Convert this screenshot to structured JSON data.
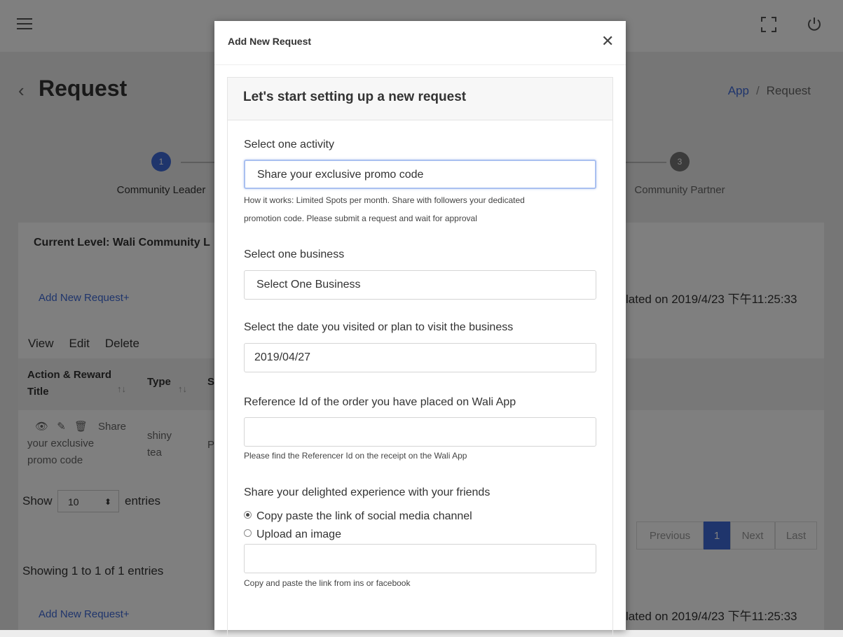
{
  "header": {
    "menu_icon": "hamburger-icon",
    "fullscreen_icon": "fullscreen-icon",
    "power_icon": "power-icon"
  },
  "page": {
    "title": "Request",
    "back_icon": "chevron-left-icon"
  },
  "breadcrumb": {
    "app": "App",
    "separator": "/",
    "current": "Request"
  },
  "steps": [
    {
      "number": "1",
      "label": "Community Leader",
      "color": "#3f6ad8"
    },
    {
      "number": "3",
      "label": "Community Partner",
      "color": "#777777"
    }
  ],
  "level": {
    "text": "Current Level: Wali Community L"
  },
  "add_request": {
    "top_label": "Add New Request+",
    "bottom_label": "Add New Request+"
  },
  "updated": {
    "top": "lated on 2019/4/23 下午11:25:33",
    "bottom": "lated on 2019/4/23 下午11:25:33"
  },
  "toolbar": {
    "view": "View",
    "edit": "Edit",
    "delete": "Delete"
  },
  "table": {
    "headers": {
      "title_line1": "Action & Reward",
      "title_line2": "Title",
      "type": "Type",
      "status_partial": "S"
    },
    "row": {
      "title_suffix": "Share",
      "title_line2": "your exclusive",
      "title_line3": "promo code",
      "type_line1": "shiny",
      "type_line2": "tea",
      "extra": "P"
    }
  },
  "entries": {
    "show": "Show",
    "value": "10",
    "suffix": "entries",
    "summary": "Showing 1 to 1 of 1 entries"
  },
  "pagination": {
    "previous": "Previous",
    "page": "1",
    "next": "Next",
    "last": "Last"
  },
  "modal": {
    "title": "Add New Request",
    "close_icon": "close-icon",
    "header": "Let's start setting up a new request",
    "activity": {
      "label": "Select one activity",
      "value": "Share your exclusive promo code",
      "help_line1": "How it works: Limited Spots per month. Share with followers your dedicated",
      "help_line2": "promotion code. Please submit a request and wait for approval"
    },
    "business": {
      "label": "Select one business",
      "value": "Select One Business"
    },
    "date": {
      "label": "Select the date you visited or plan to visit the business",
      "value": "2019/04/27"
    },
    "reference": {
      "label": "Reference Id of the order you have placed on Wali App",
      "value": "",
      "help": "Please find the Referencer Id on the receipt on the Wali App"
    },
    "share": {
      "label": "Share your delighted experience with your friends",
      "option_link": "Copy paste the link of social media channel",
      "option_upload": "Upload an image",
      "value": "",
      "help": "Copy and paste the link from ins or facebook"
    }
  }
}
